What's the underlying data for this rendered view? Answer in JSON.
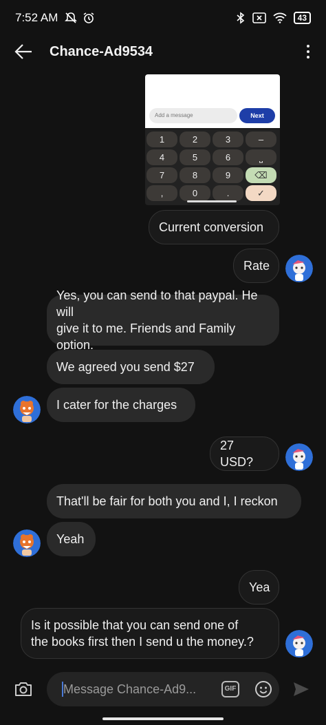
{
  "status_bar": {
    "time": "7:52 AM",
    "battery": "43"
  },
  "header": {
    "title": "Chance-Ad9534"
  },
  "shared_image": {
    "input_placeholder": "Add a message",
    "next_label": "Next",
    "keys": [
      [
        "1",
        "2",
        "3",
        "–"
      ],
      [
        "4",
        "5",
        "6",
        "⎵"
      ],
      [
        "7",
        "8",
        "9",
        "⌫"
      ],
      [
        ",",
        "0",
        ".",
        "✓"
      ]
    ]
  },
  "messages": [
    {
      "text": "Current conversion"
    },
    {
      "text": "Rate"
    },
    {
      "line1": "Yes, you can send to that paypal. He will",
      "line2": "give it to me. Friends and Family option."
    },
    {
      "text": "We agreed  you send $27"
    },
    {
      "text": "I cater for the charges"
    },
    {
      "text": "27 USD?"
    },
    {
      "text": "That'll be fair for both you and I, I reckon"
    },
    {
      "text": "Yeah"
    },
    {
      "text": "Yea"
    },
    {
      "line1": "Is it possible that you can send one of",
      "line2": "the books first then I send u the money.?"
    }
  ],
  "composer": {
    "placeholder": "Message Chance-Ad9...",
    "gif_label": "GIF"
  },
  "colors": {
    "background": "#121212",
    "bubble": "#2a2a2a",
    "accent_blue": "#1e3ea8",
    "avatar_blue": "#2f6fd8",
    "avatar_orange": "#e8742c"
  }
}
